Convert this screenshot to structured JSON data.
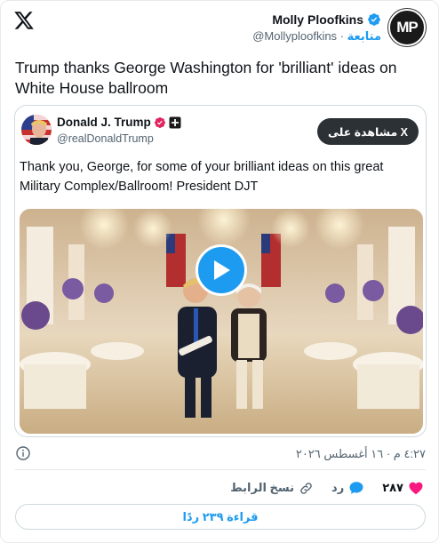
{
  "header": {
    "author_name": "Molly Ploofkins",
    "author_handle": "@Mollyploofkins",
    "follow_label": "متابعة",
    "separator": "·",
    "avatar_initials": "MP"
  },
  "tweet": {
    "text": "Trump thanks George Washington for 'brilliant' ideas on White House ballroom"
  },
  "quote": {
    "name": "Donald J. Trump",
    "handle": "@realDonaldTrump",
    "view_on_x_label": "مشاهدة على X",
    "text": "Thank you, George, for some of your brilliant ideas on this great Military Complex/Ballroom! President DJT"
  },
  "meta": {
    "timestamp": "٤:٢٧ م · ١٦ أغسطس ٢٠٢٦"
  },
  "actions": {
    "like_count": "٢٨٧",
    "reply_label": "رد",
    "copy_link_label": "نسخ الرابط"
  },
  "read_replies_label": "قراءة ٢٣٩ ردًا",
  "colors": {
    "accent": "#1d9bf0",
    "like": "#f91880",
    "dark_button": "#2c3136"
  },
  "icons": {
    "logo": "x-logo-icon",
    "verified": "verified-badge-icon",
    "like": "heart-icon",
    "reply": "speech-bubble-icon",
    "copy": "link-icon",
    "info": "info-icon",
    "play": "play-icon"
  }
}
